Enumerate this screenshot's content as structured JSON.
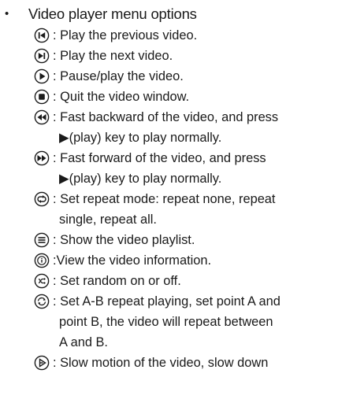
{
  "section": {
    "bullet": "•",
    "title": "Video player menu options"
  },
  "items": [
    {
      "icon": "previous-icon",
      "text": ": Play the previous video."
    },
    {
      "icon": "next-icon",
      "text": ": Play the next video."
    },
    {
      "icon": "play-pause-icon",
      "text": ": Pause/play the video."
    },
    {
      "icon": "stop-icon",
      "text": ": Quit the video window."
    },
    {
      "icon": "fast-backward-icon",
      "text": ": Fast backward of the video, and press",
      "cont": "▶(play) key to play normally."
    },
    {
      "icon": "fast-forward-icon",
      "text": ": Fast forward of the video, and press",
      "cont": "▶(play) key to play normally."
    },
    {
      "icon": "repeat-icon",
      "text": ": Set repeat mode: repeat none, repeat",
      "cont": "single, repeat all."
    },
    {
      "icon": "playlist-icon",
      "text": ": Show the video playlist."
    },
    {
      "icon": "info-icon",
      "text": ":View the video information."
    },
    {
      "icon": "random-icon",
      "text": ": Set random on or off."
    },
    {
      "icon": "ab-repeat-icon",
      "text": ": Set A-B repeat playing, set point A and",
      "cont": "point B, the video will repeat between",
      "cont2": "A and B."
    },
    {
      "icon": "slow-motion-icon",
      "text": ": Slow motion of the video, slow down"
    }
  ]
}
